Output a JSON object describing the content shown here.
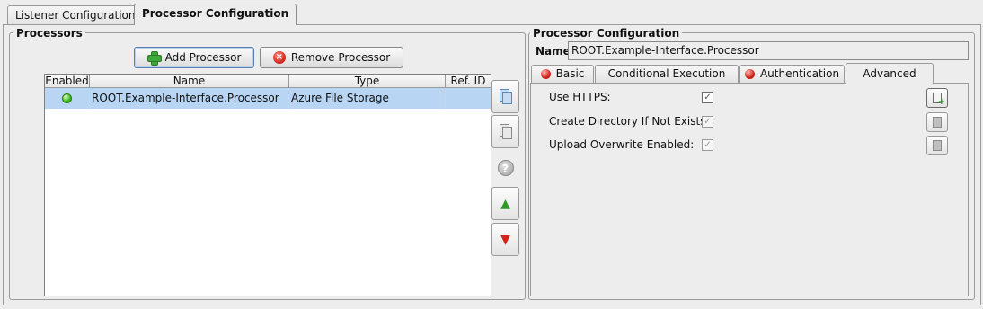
{
  "top_tabs": [
    {
      "label": "Listener Configuration",
      "active": false
    },
    {
      "label": "Processor Configuration",
      "active": true
    }
  ],
  "processors": {
    "title": "Processors",
    "add_label": "Add Processor",
    "remove_label": "Remove Processor",
    "columns": [
      "Enabled",
      "Name",
      "Type",
      "Ref. ID"
    ],
    "rows": [
      {
        "enabled": true,
        "name": "ROOT.Example-Interface.Processor",
        "type": "Azure File Storage",
        "ref_id": ""
      }
    ]
  },
  "config": {
    "title": "Processor Configuration",
    "name_label": "Name:",
    "name_value": "ROOT.Example-Interface.Processor",
    "tabs": [
      {
        "label": "Basic",
        "error": true,
        "active": false
      },
      {
        "label": "Conditional Execution",
        "error": false,
        "active": false
      },
      {
        "label": "Authentication",
        "error": true,
        "active": false
      },
      {
        "label": "Advanced",
        "error": false,
        "active": true
      }
    ],
    "options": [
      {
        "label": "Use HTTPS:",
        "checked": true,
        "enabled": true
      },
      {
        "label": "Create Directory If Not Exists:",
        "checked": true,
        "enabled": false
      },
      {
        "label": "Upload Overwrite Enabled:",
        "checked": true,
        "enabled": false
      }
    ]
  },
  "colors": {
    "selection": "#b8d6f3",
    "background": "#ededed",
    "error_red": "#d3221a",
    "ok_green": "#3cbb1a"
  }
}
